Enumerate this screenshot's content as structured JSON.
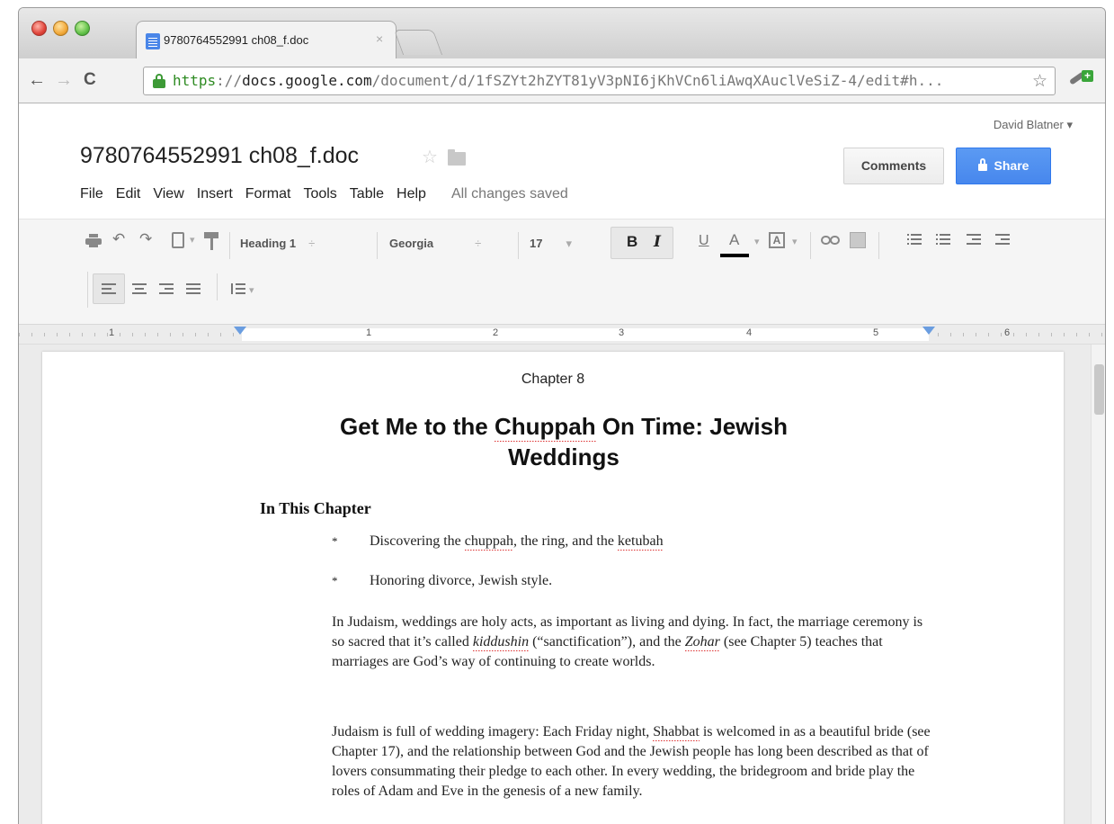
{
  "browser": {
    "tab_title": "9780764552991 ch08_f.doc",
    "tab_close": "×",
    "url_scheme": "https",
    "url_sep": "://",
    "url_host": "docs.google.com",
    "url_path": "/document/d/1fSZYt2hZYT81yV3pNI6jKhVCn6liAwqXAuclVeSiZ-4/edit#h...",
    "back_glyph": "←",
    "forward_glyph": "→",
    "reload_glyph": "C",
    "bookmark_glyph": "☆",
    "extension_glyph": "+"
  },
  "docs": {
    "account": "David Blatner ▾",
    "title": "9780764552991 ch08_f.doc",
    "title_star": "☆",
    "menu": [
      "File",
      "Edit",
      "View",
      "Insert",
      "Format",
      "Tools",
      "Table",
      "Help"
    ],
    "save_status": "All changes saved",
    "comments_label": "Comments",
    "share_label": "Share"
  },
  "toolbar": {
    "style_value": "Heading 1",
    "font_value": "Georgia",
    "size_value": "17",
    "bold_label": "B",
    "italic_label": "I",
    "underline_label": "U",
    "text_color_label": "A",
    "highlight_label": "A",
    "updown_arrow": "÷",
    "down_arrow": "▾"
  },
  "ruler": {
    "numbers": [
      "1",
      "1",
      "2",
      "3",
      "4",
      "5",
      "6"
    ]
  },
  "document": {
    "chapter": "Chapter 8",
    "heading_part1": "Get Me to the ",
    "heading_word": "Chuppah",
    "heading_part2": " On Time: Jewish Weddings",
    "subheading": "In This Chapter",
    "bullet_glyph": "*",
    "bullet1_a": "Discovering the ",
    "bullet1_b": "chuppah",
    "bullet1_c": ", the ring, and the ",
    "bullet1_d": "ketubah",
    "bullet2": "Honoring divorce, Jewish style.",
    "p1_a": "In Judaism, weddings are holy acts, as important as living and dying. In fact, the marriage ceremony is so sacred that it’s called ",
    "p1_b": "kiddushin",
    "p1_c": " (“sanctification”), and the ",
    "p1_d": "Zohar",
    "p1_e": " (see Chapter 5) teaches that marriages are God’s way of continuing to create worlds.",
    "p2_a": "Judaism is full of wedding imagery: Each Friday night, ",
    "p2_b": "Shabbat",
    "p2_c": " is welcomed in as a beautiful bride (see Chapter 17), and the relationship between God and the Jewish people has long been described as that of lovers consummating their pledge to each other. In every wedding, the bridegroom and bride play the roles of Adam and Eve in the genesis of a new family."
  },
  "colors": {
    "share_blue": "#4787ed",
    "secure_green": "#2e8b22",
    "spell_red": "#dd3333"
  }
}
